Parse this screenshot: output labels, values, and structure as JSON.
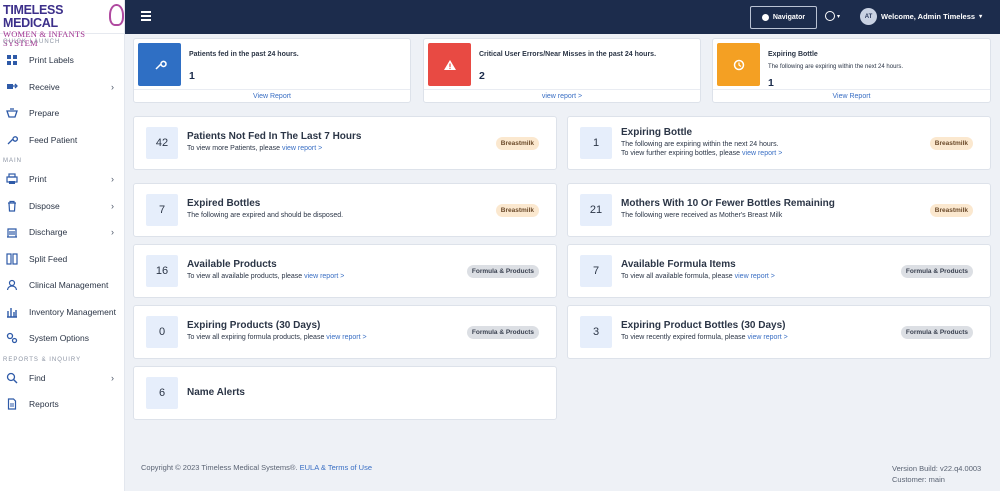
{
  "brand": {
    "name_main": "TIMELESS MEDICAL",
    "name_sub": "WOMEN & INFANTS SYSTEM"
  },
  "sidebar": {
    "quick_launch_title": "QUICK LAUNCH",
    "main_title": "MAIN",
    "reports_title": "REPORTS & INQUIRY",
    "quick_items": [
      {
        "label": "Print Labels",
        "icon": "grid-icon",
        "chevron": false
      },
      {
        "label": "Receive",
        "icon": "receive-icon",
        "chevron": true
      },
      {
        "label": "Prepare",
        "icon": "prepare-icon",
        "chevron": false
      },
      {
        "label": "Feed Patient",
        "icon": "feed-icon",
        "chevron": false
      }
    ],
    "main_items": [
      {
        "label": "Print",
        "icon": "printer-icon",
        "chevron": true
      },
      {
        "label": "Dispose",
        "icon": "trash-icon",
        "chevron": true
      },
      {
        "label": "Discharge",
        "icon": "building-icon",
        "chevron": true
      },
      {
        "label": "Split Feed",
        "icon": "split-icon",
        "chevron": false
      },
      {
        "label": "Clinical Management",
        "icon": "user-icon",
        "chevron": false
      },
      {
        "label": "Inventory Management",
        "icon": "inventory-icon",
        "chevron": false
      },
      {
        "label": "System Options",
        "icon": "gears-icon",
        "chevron": false
      }
    ],
    "report_items": [
      {
        "label": "Find",
        "icon": "search-icon",
        "chevron": true
      },
      {
        "label": "Reports",
        "icon": "document-icon",
        "chevron": false
      }
    ]
  },
  "topbar": {
    "navigator_label": "Navigator",
    "avatar_initials": "AT",
    "welcome_text": "Welcome, Admin Timeless"
  },
  "top_cards": [
    {
      "title": "Patients fed in the past 24 hours.",
      "subtitle": "",
      "value": "1",
      "link": "View Report",
      "color": "#2f6fc4",
      "icon": "feed-icon"
    },
    {
      "title": "Critical User Errors/Near Misses in the past 24 hours.",
      "subtitle": "",
      "value": "2",
      "link": "view report >",
      "color": "#e84a43",
      "icon": "warning-icon"
    },
    {
      "title": "Expiring Bottle",
      "subtitle": "The following are expiring within the next 24 hours.",
      "value": "1",
      "link": "View Report",
      "color": "#f4a023",
      "icon": "history-icon"
    }
  ],
  "cards": [
    {
      "value": "42",
      "title": "Patients Not Fed In The Last 7 Hours",
      "desc1": "To view more Patients, please ",
      "desc1_link": "view report >",
      "desc2": "",
      "desc2_link": "",
      "badge": "Breastmilk"
    },
    {
      "value": "1",
      "title": "Expiring Bottle",
      "desc1": "The following are expiring within the next 24 hours.",
      "desc1_link": "",
      "desc2": "To view further expiring bottles, please ",
      "desc2_link": "view report >",
      "badge": "Breastmilk"
    },
    {
      "value": "7",
      "title": "Expired Bottles",
      "desc1": "The following are expired and should be disposed.",
      "desc1_link": "",
      "desc2": "",
      "desc2_link": "",
      "badge": "Breastmilk"
    },
    {
      "value": "21",
      "title": "Mothers With 10 Or Fewer Bottles Remaining",
      "desc1": "The following were received as Mother's Breast Milk",
      "desc1_link": "",
      "desc2": "",
      "desc2_link": "",
      "badge": "Breastmilk"
    },
    {
      "value": "16",
      "title": "Available Products",
      "desc1": "To view all available products, please ",
      "desc1_link": "view report >",
      "desc2": "",
      "desc2_link": "",
      "badge": "Formula & Products"
    },
    {
      "value": "7",
      "title": "Available Formula Items",
      "desc1": "To view all available formula, please ",
      "desc1_link": "view report >",
      "desc2": "",
      "desc2_link": "",
      "badge": "Formula & Products"
    },
    {
      "value": "0",
      "title": "Expiring Products (30 Days)",
      "desc1": "To view all expiring formula products, please ",
      "desc1_link": "view report >",
      "desc2": "",
      "desc2_link": "",
      "badge": "Formula & Products"
    },
    {
      "value": "3",
      "title": "Expiring Product Bottles (30 Days)",
      "desc1": "To view recently expired formula, please ",
      "desc1_link": "view report >",
      "desc2": "",
      "desc2_link": "",
      "badge": "Formula & Products"
    },
    {
      "value": "6",
      "title": "Name Alerts",
      "desc1": "",
      "desc1_link": "",
      "desc2": "",
      "desc2_link": "",
      "badge": ""
    }
  ],
  "footer": {
    "copyright": "Copyright © 2023 Timeless Medical Systems®. ",
    "eula_link": "EULA & Terms of Use",
    "version": "Version Build: v22.q4.0003",
    "customer": "Customer: main"
  }
}
